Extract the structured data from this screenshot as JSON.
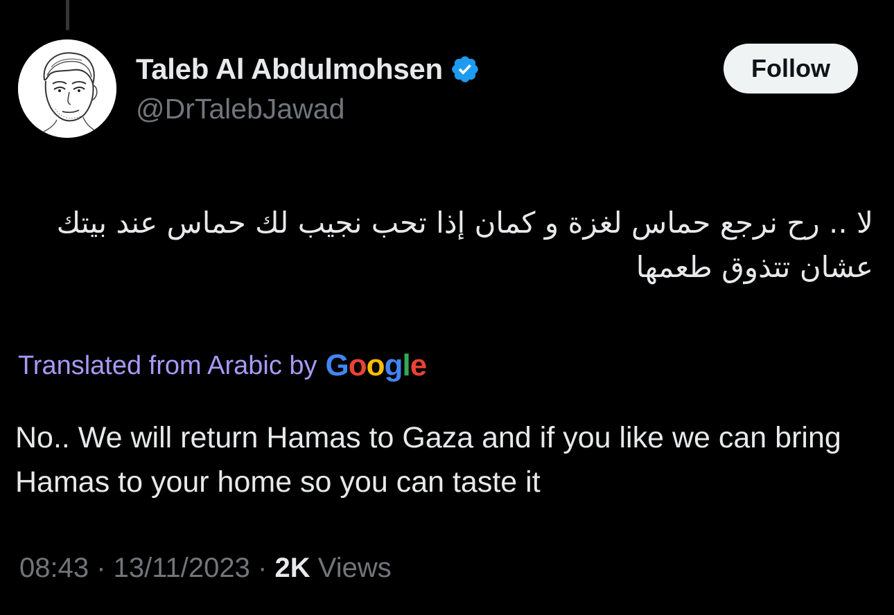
{
  "author": {
    "display_name": "Taleb Al Abdulmohsen",
    "handle": "@DrTalebJawad",
    "verified": true,
    "verified_icon": "verified-badge-icon",
    "verified_color": "#1d9bf0"
  },
  "follow_button": {
    "label": "Follow"
  },
  "tweet": {
    "original_text": "لا .. رح نرجع حماس لغزة و كمان إذا تحب نجيب لك حماس عند بيتك عشان تتذوق طعمها",
    "translation_label": "Translated from Arabic by",
    "translation_provider": {
      "letters": [
        "G",
        "o",
        "o",
        "g",
        "l",
        "e"
      ],
      "colors": [
        "#4285F4",
        "#EA4335",
        "#FBBC05",
        "#4285F4",
        "#34A853",
        "#EA4335"
      ]
    },
    "translated_text": "No.. We will return Hamas to Gaza and if you like we can bring Hamas to your home so you can taste it"
  },
  "meta": {
    "time": "08:43",
    "separator": "·",
    "date": "13/11/2023",
    "views_count": "2K",
    "views_label": "Views"
  },
  "colors": {
    "background": "#000000",
    "text_primary": "#e7e9ea",
    "text_secondary": "#71767b",
    "translate_link": "#a79af7",
    "follow_bg": "#eff3f4"
  }
}
